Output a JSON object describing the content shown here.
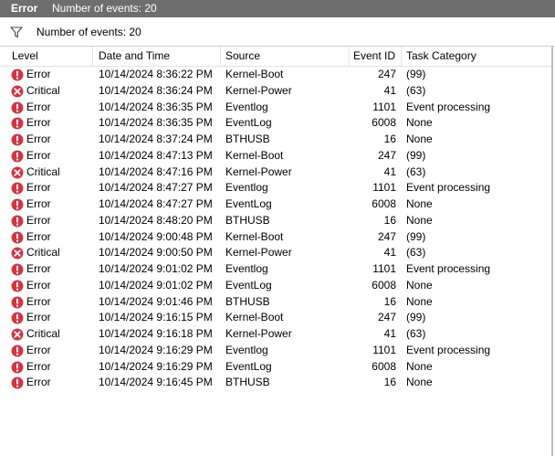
{
  "window": {
    "title": "Error",
    "subtitle": "Number of events: 20"
  },
  "filter": {
    "icon": "filter-icon",
    "label": "Number of events: 20"
  },
  "columns": {
    "level": "Level",
    "date_time": "Date and Time",
    "source": "Source",
    "event_id": "Event ID",
    "task_category": "Task Category"
  },
  "colors": {
    "error_icon": "#d6343f",
    "titlebar": "#6e6e6e"
  },
  "events": [
    {
      "level": "Error",
      "icon": "error-icon",
      "date_time": "10/14/2024 8:36:22 PM",
      "source": "Kernel-Boot",
      "event_id": "247",
      "task_category": "(99)"
    },
    {
      "level": "Critical",
      "icon": "critical-icon",
      "date_time": "10/14/2024 8:36:24 PM",
      "source": "Kernel-Power",
      "event_id": "41",
      "task_category": "(63)"
    },
    {
      "level": "Error",
      "icon": "error-icon",
      "date_time": "10/14/2024 8:36:35 PM",
      "source": "Eventlog",
      "event_id": "1101",
      "task_category": "Event processing"
    },
    {
      "level": "Error",
      "icon": "error-icon",
      "date_time": "10/14/2024 8:36:35 PM",
      "source": "EventLog",
      "event_id": "6008",
      "task_category": "None"
    },
    {
      "level": "Error",
      "icon": "error-icon",
      "date_time": "10/14/2024 8:37:24 PM",
      "source": "BTHUSB",
      "event_id": "16",
      "task_category": "None"
    },
    {
      "level": "Error",
      "icon": "error-icon",
      "date_time": "10/14/2024 8:47:13 PM",
      "source": "Kernel-Boot",
      "event_id": "247",
      "task_category": "(99)"
    },
    {
      "level": "Critical",
      "icon": "critical-icon",
      "date_time": "10/14/2024 8:47:16 PM",
      "source": "Kernel-Power",
      "event_id": "41",
      "task_category": "(63)"
    },
    {
      "level": "Error",
      "icon": "error-icon",
      "date_time": "10/14/2024 8:47:27 PM",
      "source": "Eventlog",
      "event_id": "1101",
      "task_category": "Event processing"
    },
    {
      "level": "Error",
      "icon": "error-icon",
      "date_time": "10/14/2024 8:47:27 PM",
      "source": "EventLog",
      "event_id": "6008",
      "task_category": "None"
    },
    {
      "level": "Error",
      "icon": "error-icon",
      "date_time": "10/14/2024 8:48:20 PM",
      "source": "BTHUSB",
      "event_id": "16",
      "task_category": "None"
    },
    {
      "level": "Error",
      "icon": "error-icon",
      "date_time": "10/14/2024 9:00:48 PM",
      "source": "Kernel-Boot",
      "event_id": "247",
      "task_category": "(99)"
    },
    {
      "level": "Critical",
      "icon": "critical-icon",
      "date_time": "10/14/2024 9:00:50 PM",
      "source": "Kernel-Power",
      "event_id": "41",
      "task_category": "(63)"
    },
    {
      "level": "Error",
      "icon": "error-icon",
      "date_time": "10/14/2024 9:01:02 PM",
      "source": "Eventlog",
      "event_id": "1101",
      "task_category": "Event processing"
    },
    {
      "level": "Error",
      "icon": "error-icon",
      "date_time": "10/14/2024 9:01:02 PM",
      "source": "EventLog",
      "event_id": "6008",
      "task_category": "None"
    },
    {
      "level": "Error",
      "icon": "error-icon",
      "date_time": "10/14/2024 9:01:46 PM",
      "source": "BTHUSB",
      "event_id": "16",
      "task_category": "None"
    },
    {
      "level": "Error",
      "icon": "error-icon",
      "date_time": "10/14/2024 9:16:15 PM",
      "source": "Kernel-Boot",
      "event_id": "247",
      "task_category": "(99)"
    },
    {
      "level": "Critical",
      "icon": "critical-icon",
      "date_time": "10/14/2024 9:16:18 PM",
      "source": "Kernel-Power",
      "event_id": "41",
      "task_category": "(63)"
    },
    {
      "level": "Error",
      "icon": "error-icon",
      "date_time": "10/14/2024 9:16:29 PM",
      "source": "Eventlog",
      "event_id": "1101",
      "task_category": "Event processing"
    },
    {
      "level": "Error",
      "icon": "error-icon",
      "date_time": "10/14/2024 9:16:29 PM",
      "source": "EventLog",
      "event_id": "6008",
      "task_category": "None"
    },
    {
      "level": "Error",
      "icon": "error-icon",
      "date_time": "10/14/2024 9:16:45 PM",
      "source": "BTHUSB",
      "event_id": "16",
      "task_category": "None"
    }
  ]
}
